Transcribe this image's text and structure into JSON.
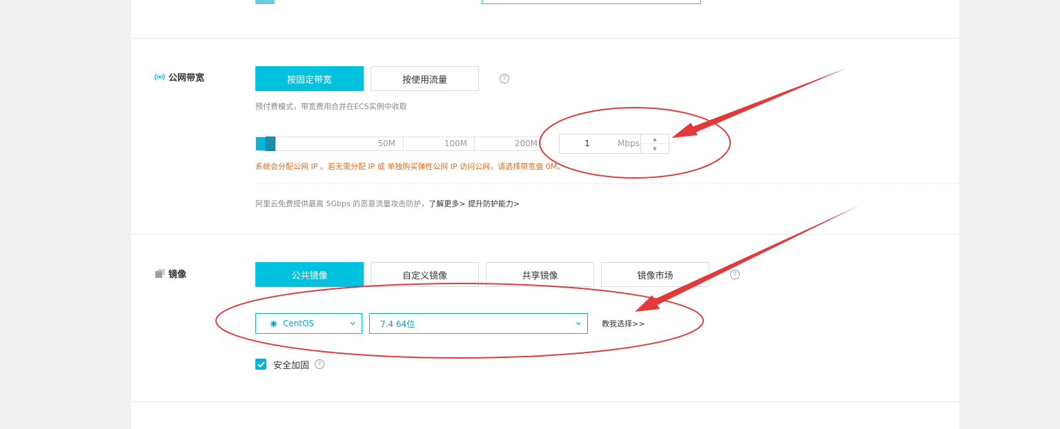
{
  "bandwidth": {
    "label": "公网带宽",
    "tabs": [
      {
        "label": "按固定带宽",
        "active": true
      },
      {
        "label": "按使用流量",
        "active": false
      }
    ],
    "help": "?",
    "note": "预付费模式，带宽费用合并在ECS实例中收取",
    "slider": {
      "ticks": [
        "50M",
        "100M",
        "200M"
      ],
      "value_mbps": 1
    },
    "input": {
      "value": "1",
      "unit": "Mbps"
    },
    "warning": "系统会分配公网 IP 。若无需分配 IP 或 单独购买弹性公网 IP 访问公网，请选择带宽值 0M。",
    "protection": {
      "text": "阿里云免费提供最高 5Gbps 的恶意流量攻击防护，",
      "learn_more": "了解更多>",
      "upgrade": "提升防护能力>"
    }
  },
  "image": {
    "label": "镜像",
    "tabs": [
      {
        "label": "公共镜像",
        "active": true
      },
      {
        "label": "自定义镜像",
        "active": false
      },
      {
        "label": "共享镜像",
        "active": false
      },
      {
        "label": "镜像市场",
        "active": false
      }
    ],
    "help": "?",
    "os_select": {
      "value": "CentOS"
    },
    "version_select": {
      "value": "7.4 64位"
    },
    "teach_link": "教我选择>>",
    "security": {
      "label": "安全加固",
      "checked": true
    }
  },
  "colors": {
    "accent": "#00c1de",
    "warning": "#e26c1e",
    "annotation": "#e23a3a"
  }
}
